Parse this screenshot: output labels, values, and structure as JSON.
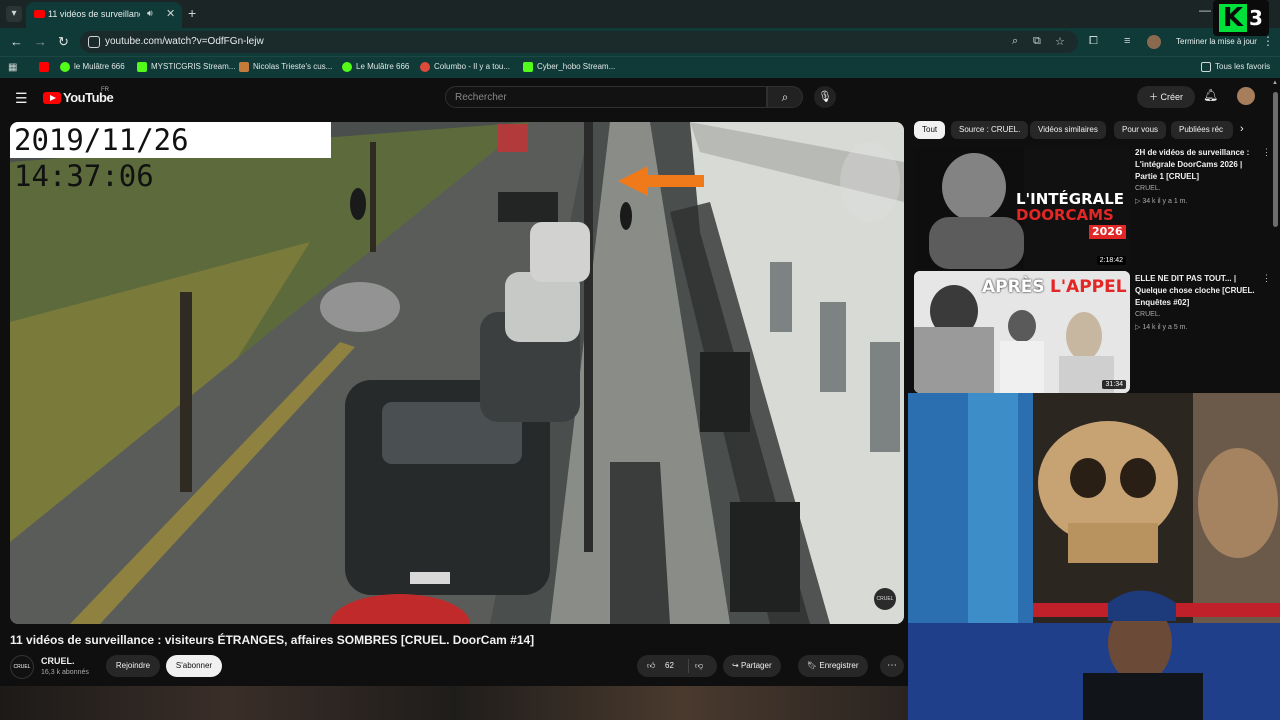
{
  "browser": {
    "tab_title": "11 vidéos de surveillance : v",
    "url": "youtube.com/watch?v=OdfFGn-lejw",
    "update_button": "Terminer la mise à jour",
    "bookmarks": [
      {
        "label": "le Mulâtre 666",
        "color": "#ff0000"
      },
      {
        "label": "le Mulâtre 666",
        "color": "#53fc18"
      },
      {
        "label": "MYSTICGRIS Stream...",
        "color": "#53fc18"
      },
      {
        "label": "Nicolas Trieste's cus...",
        "color": "#c47a3a"
      },
      {
        "label": "Le Mulâtre 666",
        "color": "#53fc18"
      },
      {
        "label": "Columbo - Il y a tou...",
        "color": "#e04a3a"
      },
      {
        "label": "Cyber_hobo Stream...",
        "color": "#53fc18"
      }
    ],
    "all_favorites": "Tous les favoris"
  },
  "overlay_logo": {
    "letter": "K",
    "number": "3"
  },
  "youtube": {
    "logo_text": "YouTube",
    "region": "FR",
    "search_placeholder": "Rechercher",
    "create_label": "Créer"
  },
  "video": {
    "timestamp": "2019/11/26 14:37:06",
    "watermark": "CRUEL",
    "title": "11 vidéos de surveillance : visiteurs ÉTRANGES, affaires SOMBRES [CRUEL. DoorCam #14]",
    "channel_name": "CRUEL.",
    "channel_avatar_text": "CRUEL",
    "subscribers": "16,3 k abonnés",
    "join_label": "Rejoindre",
    "subscribe_label": "S'abonner",
    "likes": "62",
    "share_label": "Partager",
    "save_label": "Enregistrer"
  },
  "chips": [
    "Tout",
    "Source : CRUEL.",
    "Vidéos similaires",
    "Pour vous",
    "Publiées réc"
  ],
  "recommendations": [
    {
      "title": "2H de vidéos de surveillance : L'intégrale DoorCams 2026 | Partie 1 [CRUEL]",
      "channel": "CRUEL.",
      "meta": "34 k   il y a 1 m.",
      "duration": "2:18:42",
      "thumb_text_1": "L'INTÉGRALE",
      "thumb_text_2": "DOORCAMS",
      "thumb_text_3": "2026"
    },
    {
      "title": "ELLE NE DIT PAS TOUT... | Quelque chose cloche [CRUEL. Enquêtes #02]",
      "channel": "CRUEL.",
      "meta": "14 k   il y a 5 m.",
      "duration": "31:34",
      "thumb_text_1": "APRÈS",
      "thumb_text_2": "L'APPEL"
    }
  ]
}
